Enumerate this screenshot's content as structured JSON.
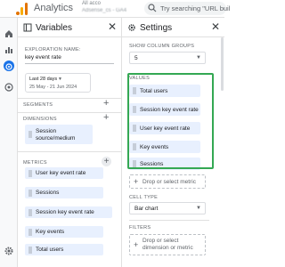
{
  "header": {
    "app_title": "Analytics",
    "account_line1": "All acco",
    "account_line2": "Adsense_cs - GA4",
    "search_placeholder": "Try searching \"URL buil"
  },
  "variables": {
    "title": "Variables",
    "exploration_name_label": "EXPLORATION NAME:",
    "exploration_name": "key event rate",
    "date_label": "Last 28 days",
    "date_range": "25 May - 21 Jun 2024",
    "segments_label": "SEGMENTS",
    "dimensions_label": "DIMENSIONS",
    "dimensions": [
      "Session\nsource/medium"
    ],
    "metrics_label": "METRICS",
    "metrics": [
      "User key event rate",
      "Sessions",
      "Session key event rate",
      "Key events",
      "Total users"
    ]
  },
  "settings": {
    "title": "Settings",
    "show_column_groups_label": "SHOW COLUMN GROUPS",
    "show_column_groups_value": "5",
    "values_label": "VALUES",
    "values": [
      "Total users",
      "Session key event rate",
      "User key event rate",
      "Key events",
      "Sessions"
    ],
    "drop_metric": "Drop or select metric",
    "cell_type_label": "CELL TYPE",
    "cell_type_value": "Bar chart",
    "filters_label": "FILTERS",
    "drop_dimension": "Drop or select dimension or metric"
  },
  "colors": {
    "highlight_border": "#34a853",
    "chip_bg": "#e8f0fe",
    "accent": "#1a73e8",
    "logo": "#e37400"
  }
}
